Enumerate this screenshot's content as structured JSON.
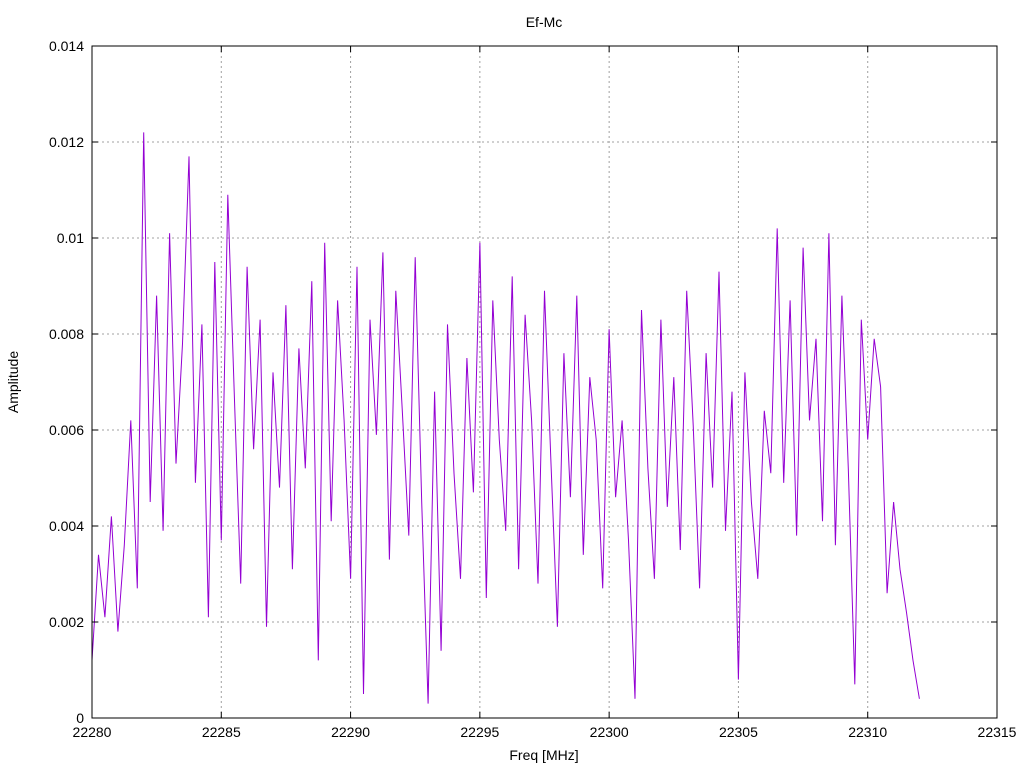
{
  "chart_data": {
    "type": "line",
    "title": "Ef-Mc",
    "xlabel": "Freq [MHz]",
    "ylabel": "Amplitude",
    "xlim": [
      22280,
      22315
    ],
    "ylim": [
      0,
      0.014
    ],
    "x_ticks": [
      22280,
      22285,
      22290,
      22295,
      22300,
      22305,
      22310,
      22315
    ],
    "x_tick_labels": [
      "22280",
      "22285",
      "22290",
      "22295",
      "22300",
      "22305",
      "22310",
      "22315"
    ],
    "y_ticks": [
      0,
      0.002,
      0.004,
      0.006,
      0.008,
      0.01,
      0.012,
      0.014
    ],
    "y_tick_labels": [
      "0",
      "0.002",
      "0.004",
      "0.006",
      "0.008",
      "0.01",
      "0.012",
      "0.014"
    ],
    "grid": true,
    "series": [
      {
        "color": "#9400d3",
        "x_start": 22280.0,
        "x_step": 0.25,
        "x": [
          22280.0,
          22280.25,
          22280.5,
          22280.75,
          22281.0,
          22281.25,
          22281.5,
          22281.75,
          22282.0,
          22282.25,
          22282.5,
          22282.75,
          22283.0,
          22283.25,
          22283.5,
          22283.75,
          22284.0,
          22284.25,
          22284.5,
          22284.75,
          22285.0,
          22285.25,
          22285.5,
          22285.75,
          22286.0,
          22286.25,
          22286.5,
          22286.75,
          22287.0,
          22287.25,
          22287.5,
          22287.75,
          22288.0,
          22288.25,
          22288.5,
          22288.75,
          22289.0,
          22289.25,
          22289.5,
          22289.75,
          22290.0,
          22290.25,
          22290.5,
          22290.75,
          22291.0,
          22291.25,
          22291.5,
          22291.75,
          22292.0,
          22292.25,
          22292.5,
          22292.75,
          22293.0,
          22293.25,
          22293.5,
          22293.75,
          22294.0,
          22294.25,
          22294.5,
          22294.75,
          22295.0,
          22295.25,
          22295.5,
          22295.75,
          22296.0,
          22296.25,
          22296.5,
          22296.75,
          22297.0,
          22297.25,
          22297.5,
          22297.75,
          22298.0,
          22298.25,
          22298.5,
          22298.75,
          22299.0,
          22299.25,
          22299.5,
          22299.75,
          22300.0,
          22300.25,
          22300.5,
          22300.75,
          22301.0,
          22301.25,
          22301.5,
          22301.75,
          22302.0,
          22302.25,
          22302.5,
          22302.75,
          22303.0,
          22303.25,
          22303.5,
          22303.75,
          22304.0,
          22304.25,
          22304.5,
          22304.75,
          22305.0,
          22305.25,
          22305.5,
          22305.75,
          22306.0,
          22306.25,
          22306.5,
          22306.75,
          22307.0,
          22307.25,
          22307.5,
          22307.75,
          22308.0,
          22308.25,
          22308.5,
          22308.75,
          22309.0,
          22309.25,
          22309.5,
          22309.75,
          22310.0,
          22310.25,
          22310.5,
          22310.75,
          22311.0,
          22311.25,
          22311.5,
          22311.75,
          22312.0
        ],
        "y": [
          0.0012,
          0.0034,
          0.0021,
          0.0042,
          0.0018,
          0.0036,
          0.0062,
          0.0027,
          0.0122,
          0.0045,
          0.0088,
          0.0039,
          0.0101,
          0.0053,
          0.0078,
          0.0117,
          0.0049,
          0.0082,
          0.0021,
          0.0095,
          0.0037,
          0.0109,
          0.0068,
          0.0028,
          0.0094,
          0.0056,
          0.0083,
          0.0019,
          0.0072,
          0.0048,
          0.0086,
          0.0031,
          0.0077,
          0.0052,
          0.0091,
          0.0012,
          0.0099,
          0.0041,
          0.0087,
          0.0062,
          0.0029,
          0.0094,
          0.0005,
          0.0083,
          0.0059,
          0.0097,
          0.0033,
          0.0089,
          0.0064,
          0.0038,
          0.0096,
          0.0045,
          0.0003,
          0.0068,
          0.0014,
          0.0082,
          0.0051,
          0.0029,
          0.0075,
          0.0047,
          0.0099,
          0.0025,
          0.0087,
          0.0058,
          0.0039,
          0.0092,
          0.0031,
          0.0084,
          0.0062,
          0.0028,
          0.0089,
          0.0053,
          0.0019,
          0.0076,
          0.0046,
          0.0088,
          0.0034,
          0.0071,
          0.0058,
          0.0027,
          0.0081,
          0.0046,
          0.0062,
          0.0037,
          0.0004,
          0.0085,
          0.0052,
          0.0029,
          0.0083,
          0.0044,
          0.0071,
          0.0035,
          0.0089,
          0.0061,
          0.0027,
          0.0076,
          0.0048,
          0.0093,
          0.0039,
          0.0068,
          0.0008,
          0.0072,
          0.0045,
          0.0029,
          0.0064,
          0.0051,
          0.0102,
          0.0049,
          0.0087,
          0.0038,
          0.0098,
          0.0062,
          0.0079,
          0.0041,
          0.0101,
          0.0036,
          0.0088,
          0.0052,
          0.0007,
          0.0083,
          0.0058,
          0.0079,
          0.0069,
          0.0026,
          0.0045,
          0.0031,
          0.0022,
          0.0012,
          0.0004
        ]
      }
    ]
  }
}
